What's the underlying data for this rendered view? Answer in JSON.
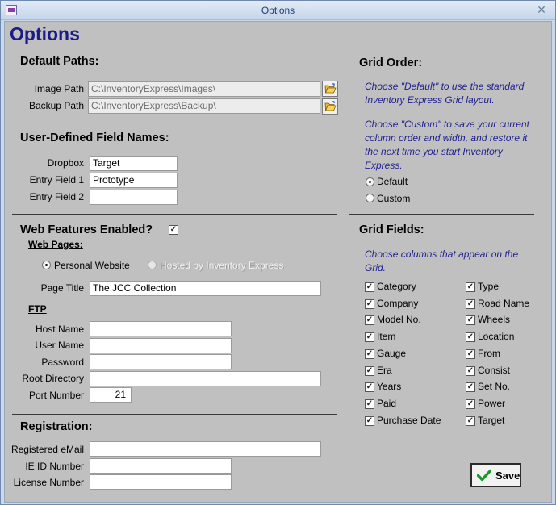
{
  "window": {
    "title": "Options",
    "close_glyph": "✕"
  },
  "page_title": "Options",
  "default_paths": {
    "heading": "Default Paths:",
    "image_path": {
      "label": "Image Path",
      "value": "C:\\InventoryExpress\\Images\\"
    },
    "backup_path": {
      "label": "Backup Path",
      "value": "C:\\InventoryExpress\\Backup\\"
    }
  },
  "user_fields": {
    "heading": "User-Defined Field Names:",
    "dropbox": {
      "label": "Dropbox",
      "value": "Target"
    },
    "entry1": {
      "label": "Entry Field 1",
      "value": "Prototype"
    },
    "entry2": {
      "label": "Entry Field 2",
      "value": ""
    }
  },
  "web": {
    "heading": "Web Features Enabled?",
    "enabled": true,
    "pages_heading": "Web Pages:",
    "personal_label": "Personal Website",
    "hosted_label": "Hosted by Inventory Express",
    "page_title_label": "Page Title",
    "page_title_value": "The JCC Collection",
    "ftp_heading": "FTP",
    "host": {
      "label": "Host Name",
      "value": ""
    },
    "user": {
      "label": "User Name",
      "value": ""
    },
    "password": {
      "label": "Password",
      "value": ""
    },
    "root": {
      "label": "Root Directory",
      "value": ""
    },
    "port": {
      "label": "Port Number",
      "value": "21"
    }
  },
  "registration": {
    "heading": "Registration:",
    "email": {
      "label": "Registered eMail",
      "value": ""
    },
    "ieid": {
      "label": "IE ID Number",
      "value": ""
    },
    "license": {
      "label": "License Number",
      "value": ""
    }
  },
  "grid_order": {
    "heading": "Grid Order:",
    "hint1": "Choose \"Default\" to use the standard Inventory Express Grid layout.",
    "hint2": "Choose \"Custom\" to save your current column order and width, and restore it the next time you start Inventory Express.",
    "default_label": "Default",
    "custom_label": "Custom",
    "selected": "Default"
  },
  "grid_fields": {
    "heading": "Grid Fields:",
    "hint": "Choose columns that appear on the Grid.",
    "col1": [
      "Category",
      "Company",
      "Model No.",
      "Item",
      "Gauge",
      "Era",
      "Years",
      "Paid",
      "Purchase Date"
    ],
    "col2": [
      "Type",
      "Road Name",
      "Wheels",
      "Location",
      "From",
      "Consist",
      "Set No.",
      "Power",
      "Target"
    ],
    "check_glyph": "✓"
  },
  "save_label": "Save",
  "colors": {
    "title_blue": "#1b1b87",
    "hint_blue": "#1f1f8f",
    "form_bg": "#c0c0c0",
    "save_check": "#1a9a2a"
  }
}
